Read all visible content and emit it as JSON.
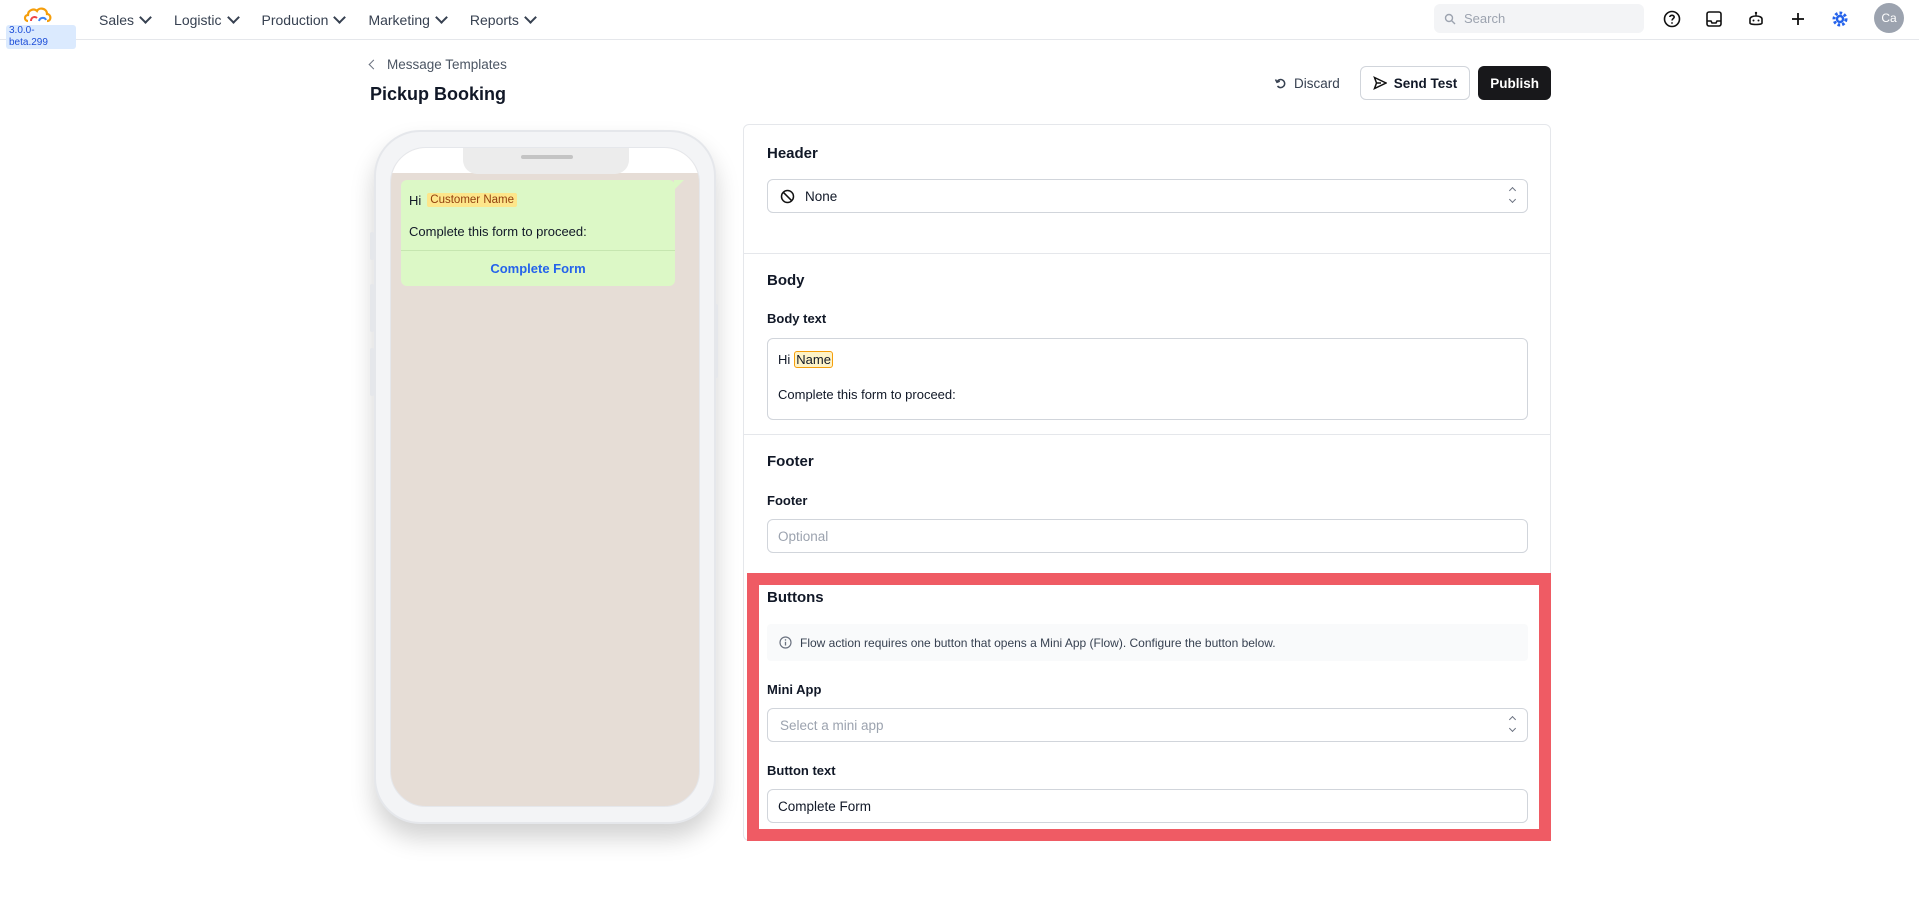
{
  "app": {
    "version": "3.0.0-beta.299",
    "colors": {
      "accent": "#2563eb",
      "highlight": "#ef5b64",
      "bubble": "#dcf8c6",
      "chat_bg": "#e6ddd6"
    }
  },
  "nav": {
    "items": [
      {
        "label": "Sales"
      },
      {
        "label": "Logistic"
      },
      {
        "label": "Production"
      },
      {
        "label": "Marketing"
      },
      {
        "label": "Reports"
      }
    ],
    "search_placeholder": "Search",
    "icons": [
      "help-icon",
      "inbox-icon",
      "bot-icon",
      "plus-icon",
      "settings-icon"
    ],
    "avatar_initials": "Ca"
  },
  "page": {
    "breadcrumb": "Message Templates",
    "title": "Pickup Booking",
    "actions": {
      "discard": "Discard",
      "send_test": "Send Test",
      "publish": "Publish"
    }
  },
  "preview": {
    "greeting": "Hi",
    "variable_chip": "Customer Name",
    "body_line": "Complete this form to proceed:",
    "button_label": "Complete Form"
  },
  "form": {
    "header": {
      "title": "Header",
      "type_value": "None"
    },
    "body": {
      "title": "Body",
      "label": "Body text",
      "greeting": "Hi",
      "variable": "Name",
      "line2": "Complete this form to proceed:"
    },
    "footer": {
      "title": "Footer",
      "label": "Footer",
      "placeholder": "Optional"
    },
    "buttons": {
      "title": "Buttons",
      "info": "Flow action requires one button that opens a Mini App (Flow). Configure the button below.",
      "mini_app_label": "Mini App",
      "mini_app_placeholder": "Select a mini app",
      "button_text_label": "Button text",
      "button_text_value": "Complete Form"
    }
  }
}
